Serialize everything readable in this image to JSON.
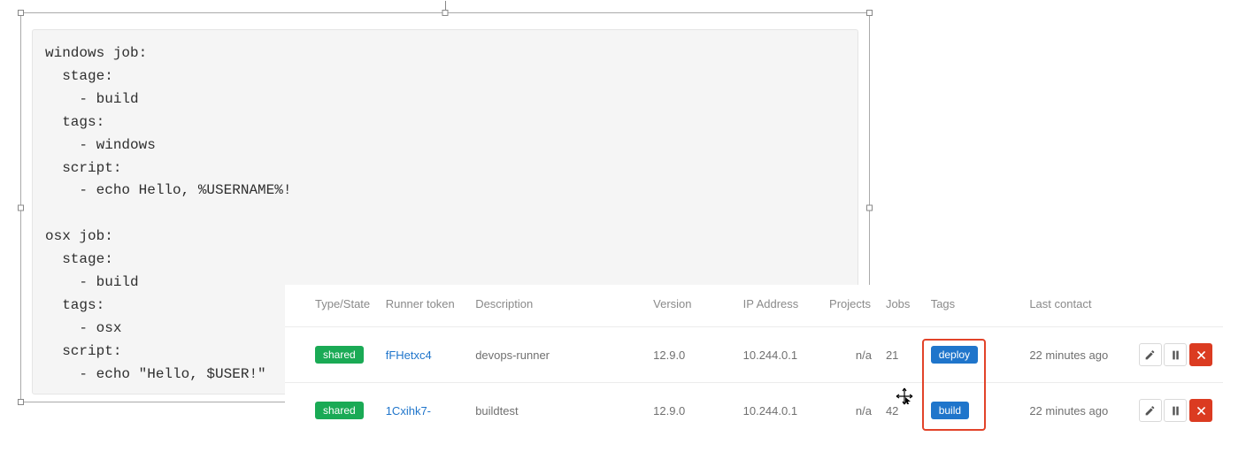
{
  "code": {
    "text": "windows job:\n  stage:\n    - build\n  tags:\n    - windows\n  script:\n    - echo Hello, %USERNAME%!\n\nosx job:\n  stage:\n    - build\n  tags:\n    - osx\n  script:\n    - echo \"Hello, $USER!\""
  },
  "runners": {
    "headers": {
      "type": "Type/State",
      "token": "Runner token",
      "desc": "Description",
      "version": "Version",
      "ip": "IP Address",
      "projects": "Projects",
      "jobs": "Jobs",
      "tags": "Tags",
      "contact": "Last contact"
    },
    "rows": [
      {
        "state": "shared",
        "token": "fFHetxc4",
        "desc": "devops-runner",
        "version": "12.9.0",
        "ip": "10.244.0.1",
        "projects": "n/a",
        "jobs": "21",
        "tag": "deploy",
        "contact": "22 minutes ago"
      },
      {
        "state": "shared",
        "token": "1Cxihk7-",
        "desc": "buildtest",
        "version": "12.9.0",
        "ip": "10.244.0.1",
        "projects": "n/a",
        "jobs": "42",
        "tag": "build",
        "contact": "22 minutes ago"
      }
    ],
    "icons": {
      "edit": "pencil-icon",
      "pause": "pause-icon",
      "remove": "close-icon"
    }
  }
}
